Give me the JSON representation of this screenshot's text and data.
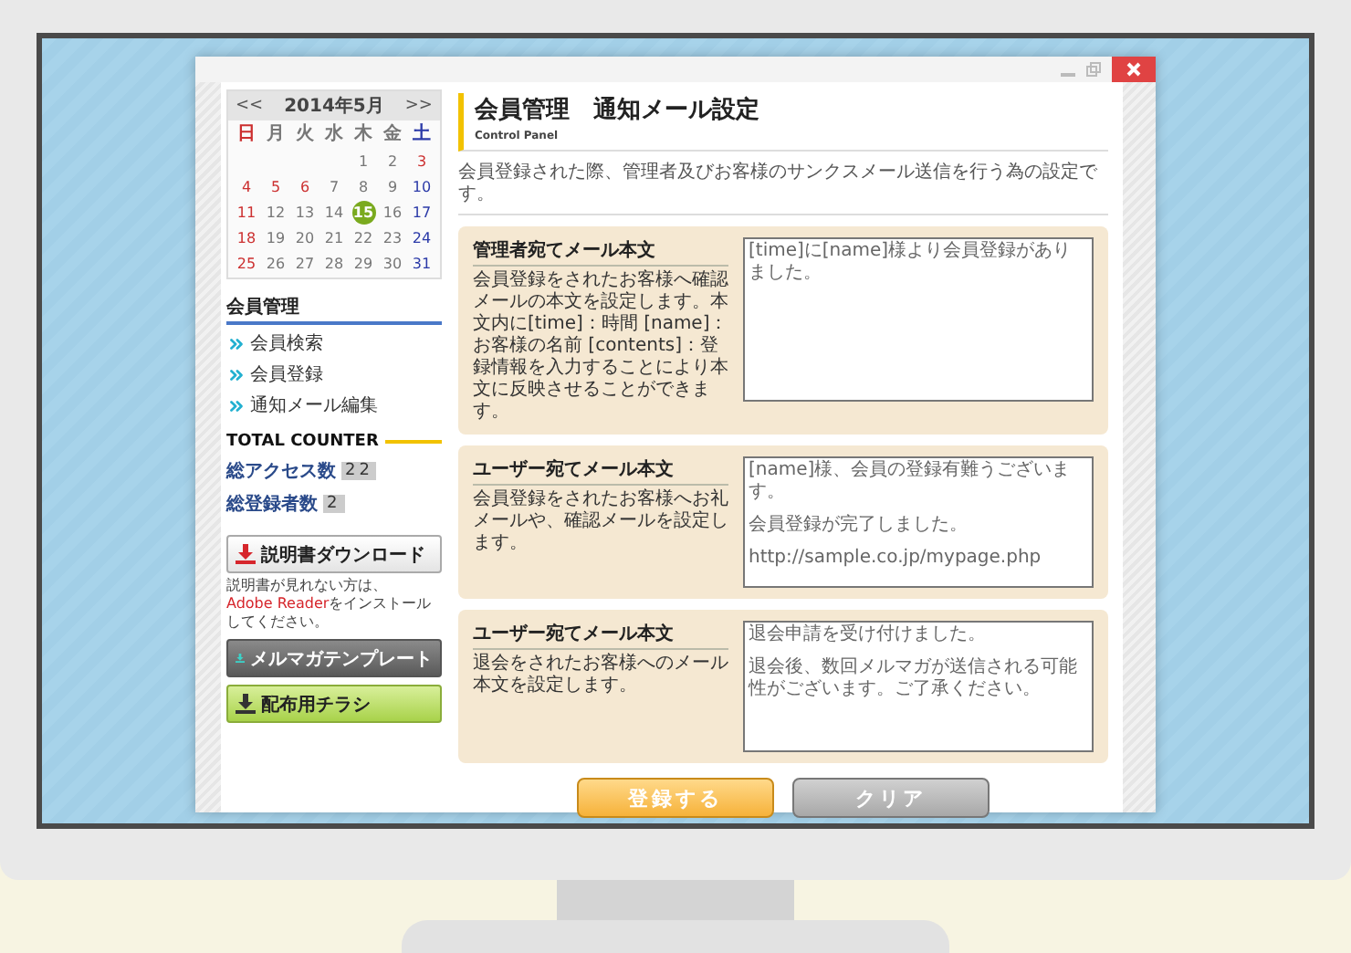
{
  "calendar": {
    "prev": "<<",
    "title": "2014年5月",
    "next": ">>",
    "weekdays": [
      {
        "label": "日",
        "kind": "sun"
      },
      {
        "label": "月",
        "kind": "weekday"
      },
      {
        "label": "火",
        "kind": "weekday"
      },
      {
        "label": "水",
        "kind": "weekday"
      },
      {
        "label": "木",
        "kind": "weekday"
      },
      {
        "label": "金",
        "kind": "weekday"
      },
      {
        "label": "土",
        "kind": "sat"
      }
    ],
    "weeks": [
      [
        {
          "kind": "blank"
        },
        {
          "kind": "blank"
        },
        {
          "kind": "blank"
        },
        {
          "kind": "blank"
        },
        {
          "d": "1",
          "kind": "weekday",
          "selected": false
        },
        {
          "d": "2",
          "kind": "weekday",
          "selected": false
        },
        {
          "d": "3",
          "kind": "holiday",
          "selected": false
        }
      ],
      [
        {
          "d": "4",
          "kind": "sun",
          "selected": false
        },
        {
          "d": "5",
          "kind": "holiday",
          "selected": false
        },
        {
          "d": "6",
          "kind": "holiday",
          "selected": false
        },
        {
          "d": "7",
          "kind": "weekday",
          "selected": false
        },
        {
          "d": "8",
          "kind": "weekday",
          "selected": false
        },
        {
          "d": "9",
          "kind": "weekday",
          "selected": false
        },
        {
          "d": "10",
          "kind": "sat",
          "selected": false
        }
      ],
      [
        {
          "d": "11",
          "kind": "sun",
          "selected": false
        },
        {
          "d": "12",
          "kind": "weekday",
          "selected": false
        },
        {
          "d": "13",
          "kind": "weekday",
          "selected": false
        },
        {
          "d": "14",
          "kind": "weekday",
          "selected": false
        },
        {
          "d": "15",
          "kind": "weekday",
          "selected": true
        },
        {
          "d": "16",
          "kind": "weekday",
          "selected": false
        },
        {
          "d": "17",
          "kind": "sat",
          "selected": false
        }
      ],
      [
        {
          "d": "18",
          "kind": "sun",
          "selected": false
        },
        {
          "d": "19",
          "kind": "weekday",
          "selected": false
        },
        {
          "d": "20",
          "kind": "weekday",
          "selected": false
        },
        {
          "d": "21",
          "kind": "weekday",
          "selected": false
        },
        {
          "d": "22",
          "kind": "weekday",
          "selected": false
        },
        {
          "d": "23",
          "kind": "weekday",
          "selected": false
        },
        {
          "d": "24",
          "kind": "sat",
          "selected": false
        }
      ],
      [
        {
          "d": "25",
          "kind": "sun",
          "selected": false
        },
        {
          "d": "26",
          "kind": "weekday",
          "selected": false
        },
        {
          "d": "27",
          "kind": "weekday",
          "selected": false
        },
        {
          "d": "28",
          "kind": "weekday",
          "selected": false
        },
        {
          "d": "29",
          "kind": "weekday",
          "selected": false
        },
        {
          "d": "30",
          "kind": "weekday",
          "selected": false
        },
        {
          "d": "31",
          "kind": "sat",
          "selected": false
        }
      ]
    ]
  },
  "sidebar": {
    "heading": "会員管理",
    "items": [
      {
        "label": "会員検索"
      },
      {
        "label": "会員登録"
      },
      {
        "label": "通知メール編集"
      }
    ],
    "counter": {
      "title": "TOTAL COUNTER",
      "rows": [
        {
          "label": "総アクセス数",
          "value": "22"
        },
        {
          "label": "総登録者数",
          "value": "2"
        }
      ]
    },
    "downloads": [
      {
        "label": "説明書ダウンロード",
        "kind": "light",
        "note": {
          "before": "説明書が見れない方は、",
          "link": "Adobe Reader",
          "after": "をインストールしてください。"
        }
      },
      {
        "label": "メルマガテンプレート",
        "kind": "dark"
      },
      {
        "label": "配布用チラシ",
        "kind": "green"
      }
    ]
  },
  "main": {
    "title": "会員管理　通知メール設定",
    "subtitle": "Control Panel",
    "description": "会員登録された際、管理者及びお客様のサンクスメール送信を行う為の設定です。",
    "sections": [
      {
        "heading": "管理者宛てメール本文",
        "description": "会員登録をされたお客様へ確認メールの本文を設定します。本文内に[time]：時間 [name]：お客様の名前 [contents]：登録情報を入力することにより本文に反映させることができます。",
        "body": [
          "[time]に[name]様より会員登録がありました。"
        ]
      },
      {
        "heading": "ユーザー宛てメール本文",
        "description": "会員登録をされたお客様へお礼メールや、確認メールを設定します。",
        "body": [
          "[name]様、会員の登録有難うございます。",
          "会員登録が完了しました。",
          "http://sample.co.jp/mypage.php"
        ]
      },
      {
        "heading": "ユーザー宛てメール本文",
        "description": "退会をされたお客様へのメール本文を設定します。",
        "body": [
          "退会申請を受け付けました。",
          "退会後、数回メルマガが送信される可能性がございます。ご了承ください。"
        ]
      }
    ],
    "buttons": [
      {
        "label": "登録する",
        "kind": "primary"
      },
      {
        "label": "クリア",
        "kind": "secondary"
      }
    ]
  }
}
